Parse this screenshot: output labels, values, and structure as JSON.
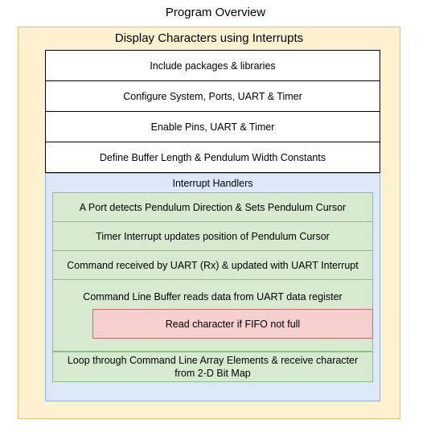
{
  "title": "Program Overview",
  "main": {
    "title": "Display Characters using Interrupts",
    "steps": [
      "Include packages & libraries",
      "Configure System, Ports, UART & Timer",
      "Enable Pins, UART & Timer",
      "Define Buffer Length & Pendulum Width Constants"
    ],
    "interrupts": {
      "label": "Interrupt Handlers",
      "items": [
        "A Port detects Pendulum Direction & Sets Pendulum Cursor",
        "Timer Interrupt updates position of Pendulum Cursor",
        "Command received by UART (Rx) & updated with UART Interrupt",
        "Command Line Buffer reads data from UART data register"
      ],
      "nested": "Read character if FIFO not full",
      "final": "Loop through Command Line Array Elements & receive character from 2-D Bit Map"
    }
  },
  "colors": {
    "outer_fill": "#fdf1cf",
    "outer_border": "#e3c373",
    "handlers_fill": "#dbe8f8",
    "green_fill": "#d6ead0",
    "red_fill": "#f6cfcf"
  }
}
